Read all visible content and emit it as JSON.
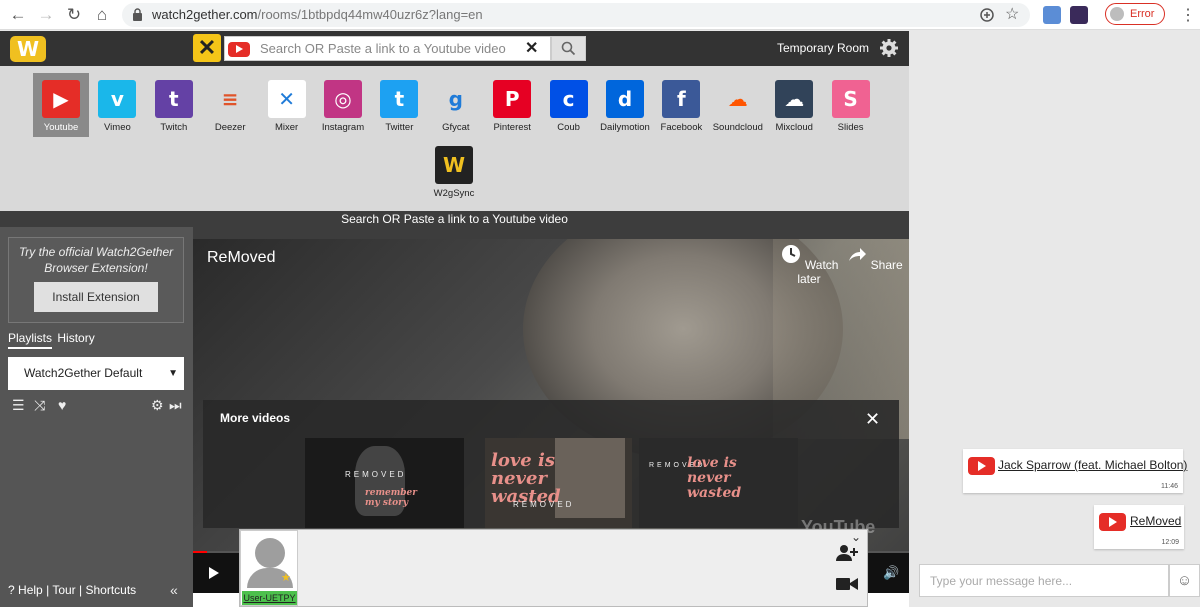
{
  "browser": {
    "url_host": "watch2gether.com",
    "url_path": "/rooms/1btbpdq44mw40uzr6z?lang=en",
    "error_label": "Error"
  },
  "topbar": {
    "search_placeholder": "Search OR Paste a link to a Youtube video",
    "room_title": "Temporary Room"
  },
  "services": [
    {
      "label": "Youtube",
      "icon": "youtube-icon",
      "color": "#e52d27",
      "glyph": "▶",
      "active": true
    },
    {
      "label": "Vimeo",
      "icon": "vimeo-icon",
      "color": "#1ab7ea",
      "glyph": "v"
    },
    {
      "label": "Twitch",
      "icon": "twitch-icon",
      "color": "#6441a5",
      "glyph": "t"
    },
    {
      "label": "Deezer",
      "icon": "deezer-icon",
      "color": "#d9d9d9",
      "glyph": "≡"
    },
    {
      "label": "Mixer",
      "icon": "mixer-icon",
      "color": "#ffffff",
      "glyph": "✕"
    },
    {
      "label": "Instagram",
      "icon": "instagram-icon",
      "color": "#c13584",
      "glyph": "◎"
    },
    {
      "label": "Twitter",
      "icon": "twitter-icon",
      "color": "#1da1f2",
      "glyph": "t"
    },
    {
      "label": "Gfycat",
      "icon": "gfycat-icon",
      "color": "#d9d9d9",
      "glyph": "g"
    },
    {
      "label": "Pinterest",
      "icon": "pinterest-icon",
      "color": "#e60023",
      "glyph": "P"
    },
    {
      "label": "Coub",
      "icon": "coub-icon",
      "color": "#0050e6",
      "glyph": "c"
    },
    {
      "label": "Dailymotion",
      "icon": "dailymotion-icon",
      "color": "#0066dc",
      "glyph": "d"
    },
    {
      "label": "Facebook",
      "icon": "facebook-icon",
      "color": "#3b5998",
      "glyph": "f"
    },
    {
      "label": "Soundcloud",
      "icon": "soundcloud-icon",
      "color": "#d9d9d9",
      "glyph": "☁"
    },
    {
      "label": "Mixcloud",
      "icon": "mixcloud-icon",
      "color": "#314359",
      "glyph": "☁"
    },
    {
      "label": "Slides",
      "icon": "slides-icon",
      "color": "#f06292",
      "glyph": "S"
    },
    {
      "label": "W2gSync",
      "icon": "w2gsync-icon",
      "color": "#222222",
      "glyph": "W"
    }
  ],
  "search_strip": "Search OR Paste a link to a Youtube video",
  "sidebar": {
    "promo_line1": "Try the official Watch2Gether",
    "promo_line2": "Browser Extension!",
    "install_label": "Install Extension",
    "tab_playlists": "Playlists",
    "tab_history": "History",
    "playlist_selected": "Watch2Gether Default",
    "help": "Help",
    "tour": "Tour",
    "shortcuts": "Shortcuts",
    "sep": "|"
  },
  "player": {
    "title": "ReMoved",
    "watch_later": "Watch later",
    "share": "Share",
    "more_videos": "More videos",
    "thumb1_text": "REMOVED",
    "thumb1_sub": "remember my story",
    "thumb2_text": "love is never wasted",
    "thumb2_sub": "REMOVED",
    "thumb3_text": "love is never wasted",
    "thumb3_sub": "REMOVED",
    "watermark": "YouTube",
    "progress": 0.02
  },
  "users": [
    {
      "name": "User-UETPY"
    }
  ],
  "chat": {
    "messages": [
      {
        "text": "Jack Sparrow (feat. Michael Bolton)",
        "time": "11:46"
      },
      {
        "text": "ReMoved",
        "time": "12:09"
      }
    ],
    "input_placeholder": "Type your message here..."
  }
}
